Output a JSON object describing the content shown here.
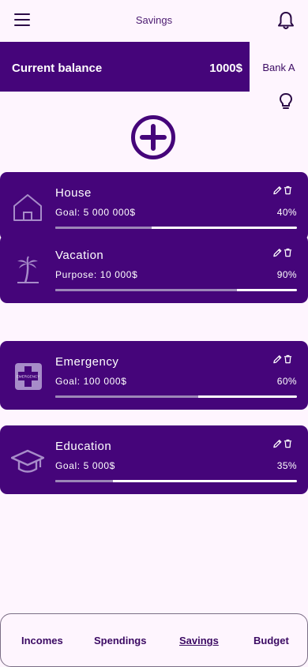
{
  "app": {
    "title": "Savings"
  },
  "balance": {
    "label": "Current balance",
    "value": "1000$"
  },
  "bank": {
    "selected": "Bank A"
  },
  "colors": {
    "primary": "#45057A",
    "background": "#FEF5FE",
    "progress_fill": "#9C86B8",
    "progress_track": "#FFFFFF"
  },
  "goals": [
    {
      "name": "House",
      "target": "Goal: 5 000 000$",
      "percent": "40%",
      "progress": 0.4,
      "icon": "house-icon"
    },
    {
      "name": "Vacation",
      "target": "Purpose: 10 000$",
      "percent": "90%",
      "progress": 0.75,
      "icon": "palm-tree-icon"
    },
    {
      "name": "Emergency",
      "target": "Goal: 100 000$",
      "percent": "60%",
      "progress": 0.59,
      "icon": "emergency-icon",
      "icon_text": "EMERGENCY"
    },
    {
      "name": "Education",
      "target": "Goal: 5 000$",
      "percent": "35%",
      "progress": 0.24,
      "icon": "graduation-cap-icon"
    }
  ],
  "nav": [
    {
      "label": "Incomes"
    },
    {
      "label": "Spendings"
    },
    {
      "label": "Savings",
      "active": true
    },
    {
      "label": "Budget"
    }
  ]
}
